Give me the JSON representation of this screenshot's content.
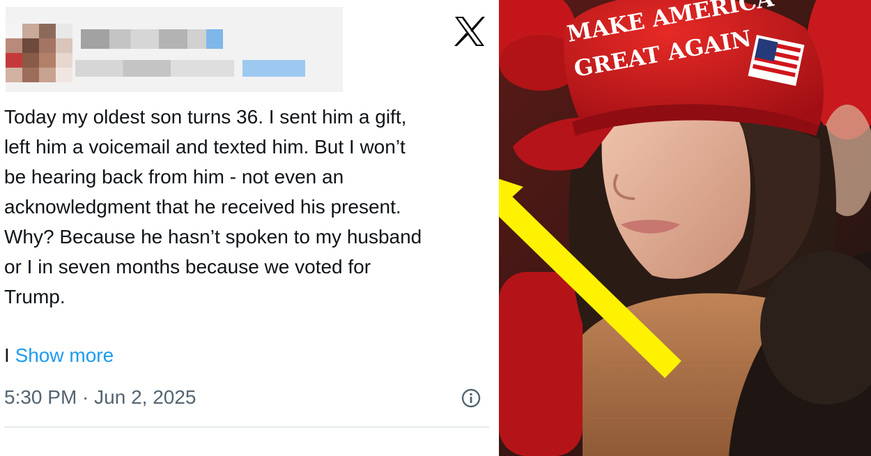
{
  "tweet": {
    "text": "Today my oldest son turns 36. I sent him a gift,\nleft him a voicemail and texted him. But I won’t\nbe hearing back from him - not even an\nacknowledgment that he received his present.\nWhy? Because he hasn’t spoken to my husband\nor I in seven months because we voted for\nTrump.",
    "continuation": "I ",
    "show_more": "Show more",
    "timestamp": "5:30 PM · Jun 2, 2025",
    "platform_icon": "x-logo-icon",
    "info_icon": "info-icon"
  },
  "photo": {
    "cap_text_line1": "MAKE AMERICA",
    "cap_text_line2": "GREAT AGAIN",
    "arrow_color": "#fff200",
    "cap_color": "#d0161b"
  }
}
